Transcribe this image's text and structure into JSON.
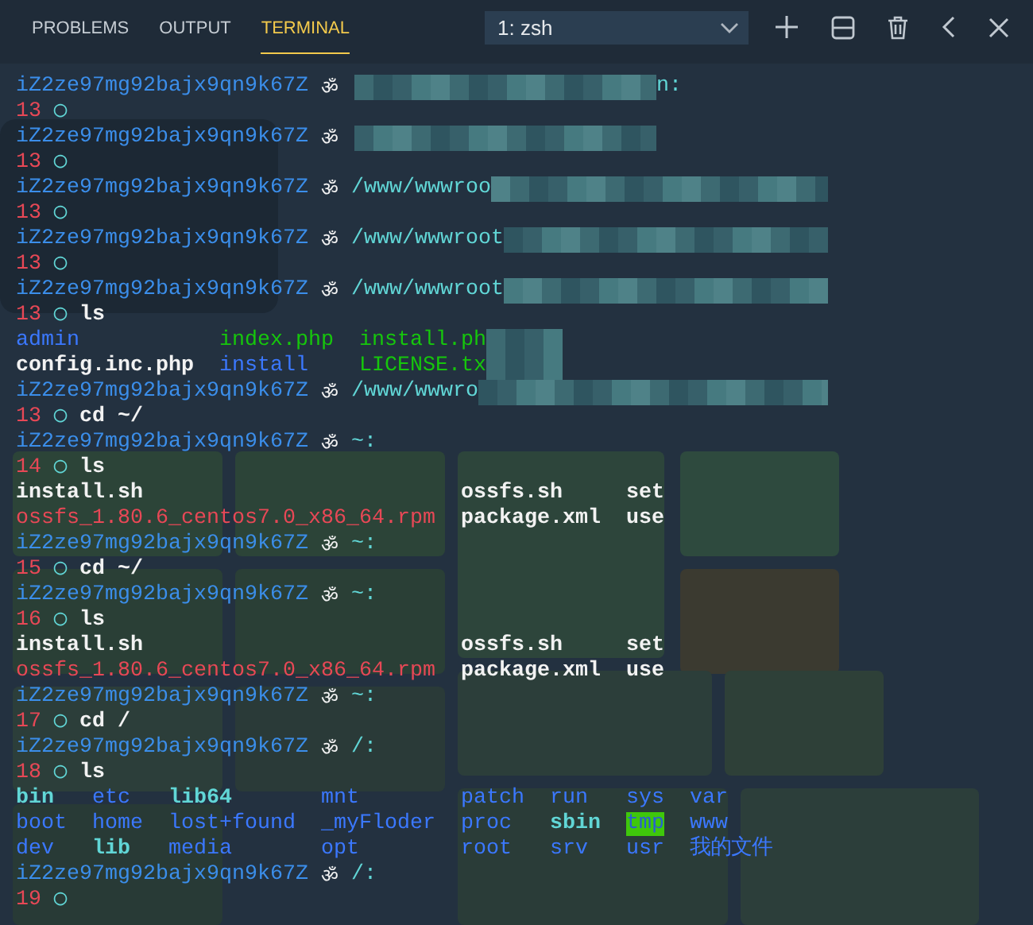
{
  "panel_tabs": [
    {
      "label": "PROBLEMS",
      "selected": false
    },
    {
      "label": "OUTPUT",
      "selected": false
    },
    {
      "label": "TERMINAL",
      "selected": true
    }
  ],
  "terminal_select": {
    "value": "1: zsh"
  },
  "lines": [
    {
      "kind": "prompt",
      "host": "iZ2ze97mg92bajx9qn9k67Z",
      "symbol": "ॐ",
      "redacted": true,
      "tail": "n:"
    },
    {
      "kind": "input",
      "number": "13",
      "marker": "◯"
    },
    {
      "kind": "prompt",
      "host": "iZ2ze97mg92bajx9qn9k67Z",
      "symbol": "ॐ",
      "redacted": true
    },
    {
      "kind": "input",
      "number": "13",
      "marker": "◯"
    },
    {
      "kind": "prompt",
      "host": "iZ2ze97mg92bajx9qn9k67Z",
      "symbol": "ॐ",
      "path": "/www/wwwroo",
      "redacted": true
    },
    {
      "kind": "input",
      "number": "13",
      "marker": "◯"
    },
    {
      "kind": "prompt",
      "host": "iZ2ze97mg92bajx9qn9k67Z",
      "symbol": "ॐ",
      "path": "/www/wwwroot",
      "redacted": true
    },
    {
      "kind": "input",
      "number": "13",
      "marker": "◯"
    },
    {
      "kind": "prompt",
      "host": "iZ2ze97mg92bajx9qn9k67Z",
      "symbol": "ॐ",
      "path": "/www/wwwroot",
      "redacted": true
    },
    {
      "kind": "input",
      "number": "13",
      "marker": "◯",
      "command": "ls"
    },
    {
      "kind": "listing",
      "redacted": true,
      "columns": [
        [
          {
            "text": "admin",
            "kind": "dir"
          },
          {
            "text": "config.inc.php",
            "kind": "file"
          }
        ],
        [
          {
            "text": "index.php",
            "kind": "exec"
          },
          {
            "text": "install",
            "kind": "dir"
          }
        ],
        [
          {
            "text": "install.ph",
            "kind": "exec"
          },
          {
            "text": "LICENSE.tx",
            "kind": "exec"
          }
        ]
      ]
    },
    {
      "kind": "prompt",
      "host": "iZ2ze97mg92bajx9qn9k67Z",
      "symbol": "ॐ",
      "path": "/www/wwwro",
      "redacted": true
    },
    {
      "kind": "input",
      "number": "13",
      "marker": "◯",
      "command": "cd ~/"
    },
    {
      "kind": "prompt",
      "host": "iZ2ze97mg92bajx9qn9k67Z",
      "symbol": "ॐ",
      "path": "~:",
      "redacted": false
    },
    {
      "kind": "input",
      "number": "14",
      "marker": "◯",
      "command": "ls"
    },
    {
      "kind": "listing",
      "redacted": false,
      "columns": [
        [
          {
            "text": "install.sh",
            "kind": "file"
          },
          {
            "text": "ossfs_1.80.6_centos7.0_x86_64.rpm",
            "kind": "archive"
          }
        ],
        [
          {
            "text": "ossfs.sh",
            "kind": "file"
          },
          {
            "text": "package.xml",
            "kind": "file"
          }
        ],
        [
          {
            "text": "set",
            "kind": "file"
          },
          {
            "text": "use",
            "kind": "file"
          }
        ]
      ]
    },
    {
      "kind": "prompt",
      "host": "iZ2ze97mg92bajx9qn9k67Z",
      "symbol": "ॐ",
      "path": "~:",
      "redacted": false
    },
    {
      "kind": "input",
      "number": "15",
      "marker": "◯",
      "command": "cd ~/"
    },
    {
      "kind": "prompt",
      "host": "iZ2ze97mg92bajx9qn9k67Z",
      "symbol": "ॐ",
      "path": "~:",
      "redacted": false
    },
    {
      "kind": "input",
      "number": "16",
      "marker": "◯",
      "command": "ls"
    },
    {
      "kind": "listing",
      "redacted": false,
      "columns": [
        [
          {
            "text": "install.sh",
            "kind": "file"
          },
          {
            "text": "ossfs_1.80.6_centos7.0_x86_64.rpm",
            "kind": "archive"
          }
        ],
        [
          {
            "text": "ossfs.sh",
            "kind": "file"
          },
          {
            "text": "package.xml",
            "kind": "file"
          }
        ],
        [
          {
            "text": "set",
            "kind": "file"
          },
          {
            "text": "use",
            "kind": "file"
          }
        ]
      ]
    },
    {
      "kind": "prompt",
      "host": "iZ2ze97mg92bajx9qn9k67Z",
      "symbol": "ॐ",
      "path": "~:",
      "redacted": false
    },
    {
      "kind": "input",
      "number": "17",
      "marker": "◯",
      "command": "cd /"
    },
    {
      "kind": "prompt",
      "host": "iZ2ze97mg92bajx9qn9k67Z",
      "symbol": "ॐ",
      "path": "/:",
      "redacted": false
    },
    {
      "kind": "input",
      "number": "18",
      "marker": "◯",
      "command": "ls"
    },
    {
      "kind": "listing",
      "redacted": false,
      "columns": [
        [
          {
            "text": "bin",
            "kind": "link"
          },
          {
            "text": "boot",
            "kind": "dir"
          },
          {
            "text": "dev",
            "kind": "dir"
          }
        ],
        [
          {
            "text": "etc",
            "kind": "dir"
          },
          {
            "text": "home",
            "kind": "dir"
          },
          {
            "text": "lib",
            "kind": "link"
          }
        ],
        [
          {
            "text": "lib64",
            "kind": "link"
          },
          {
            "text": "lost+found",
            "kind": "dir"
          },
          {
            "text": "media",
            "kind": "dir"
          }
        ],
        [
          {
            "text": "mnt",
            "kind": "dir"
          },
          {
            "text": "_myFloder",
            "kind": "dir"
          },
          {
            "text": "opt",
            "kind": "dir"
          }
        ],
        [
          {
            "text": "patch",
            "kind": "dir"
          },
          {
            "text": "proc",
            "kind": "dir"
          },
          {
            "text": "root",
            "kind": "dir"
          }
        ],
        [
          {
            "text": "run",
            "kind": "dir"
          },
          {
            "text": "sbin",
            "kind": "link"
          },
          {
            "text": "srv",
            "kind": "dir"
          }
        ],
        [
          {
            "text": "sys",
            "kind": "dir"
          },
          {
            "text": "tmp",
            "kind": "sticky"
          },
          {
            "text": "usr",
            "kind": "dir"
          }
        ],
        [
          {
            "text": "var",
            "kind": "dir"
          },
          {
            "text": "www",
            "kind": "dir"
          },
          {
            "text": "我的文件",
            "kind": "dir"
          }
        ]
      ]
    },
    {
      "kind": "prompt",
      "host": "iZ2ze97mg92bajx9qn9k67Z",
      "symbol": "ॐ",
      "path": "/:",
      "redacted": false
    },
    {
      "kind": "input",
      "number": "19",
      "marker": "◯"
    }
  ]
}
